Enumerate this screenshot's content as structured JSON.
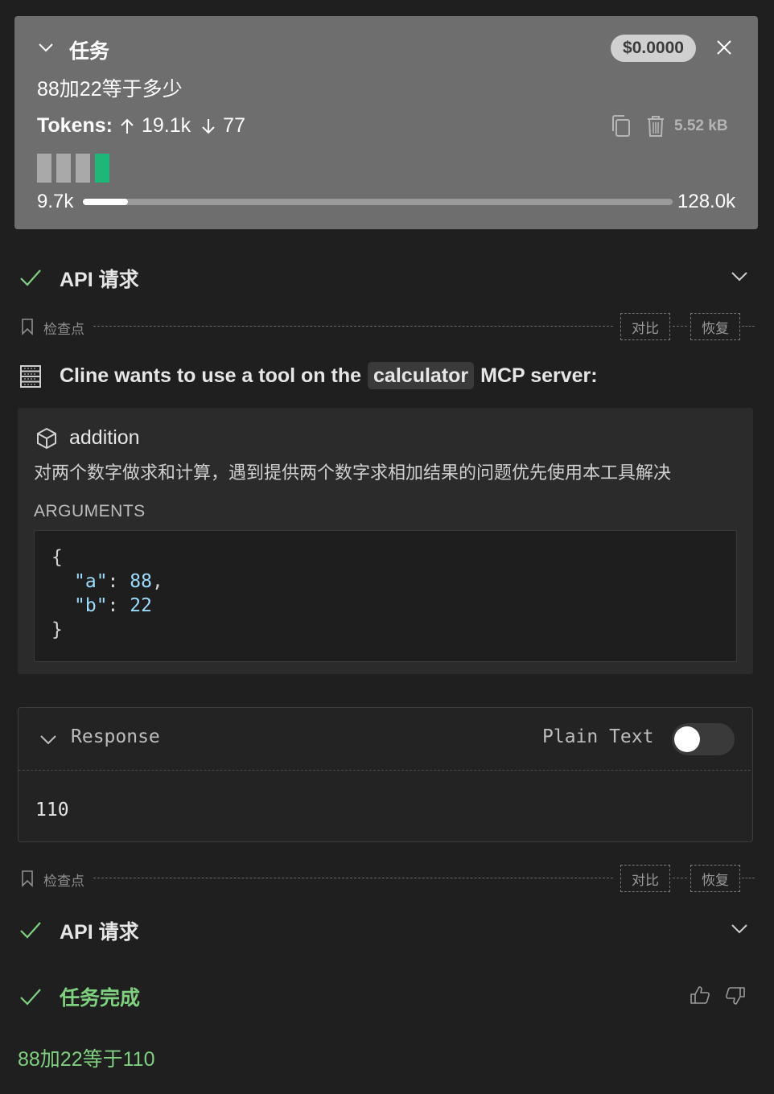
{
  "task": {
    "title": "任务",
    "cost": "$0.0000",
    "question": "88加22等于多少",
    "tokens_label": "Tokens:",
    "tokens_up": "19.1k",
    "tokens_down": "77",
    "size": "5.52 kB",
    "context_used": "9.7k",
    "context_total": "128.0k",
    "context_progress": 0.076
  },
  "api_request_1": {
    "label": "API 请求"
  },
  "checkpoint_1": {
    "label": "检查点",
    "compare": "对比",
    "restore": "恢复"
  },
  "mcp": {
    "heading_prefix": "Cline wants to use a tool on the",
    "server": "calculator",
    "heading_suffix": "MCP server:",
    "tool_name": "addition",
    "tool_description": "对两个数字做求和计算，遇到提供两个数字求相加结果的问题优先使用本工具解决",
    "arguments_label": "ARGUMENTS",
    "args": {
      "open": "{",
      "a_key": "\"a\"",
      "a_val": "88",
      "b_key": "\"b\"",
      "b_val": "22",
      "close": "}"
    }
  },
  "response": {
    "title": "Response",
    "plain_text_label": "Plain Text",
    "plain_text_enabled": false,
    "value": "110"
  },
  "checkpoint_2": {
    "label": "检查点",
    "compare": "对比",
    "restore": "恢复"
  },
  "api_request_2": {
    "label": "API 请求"
  },
  "completion": {
    "title": "任务完成",
    "answer": "88加22等于110"
  },
  "colors": {
    "success_green": "#7fd07f",
    "context_green": "#1fb67a"
  }
}
